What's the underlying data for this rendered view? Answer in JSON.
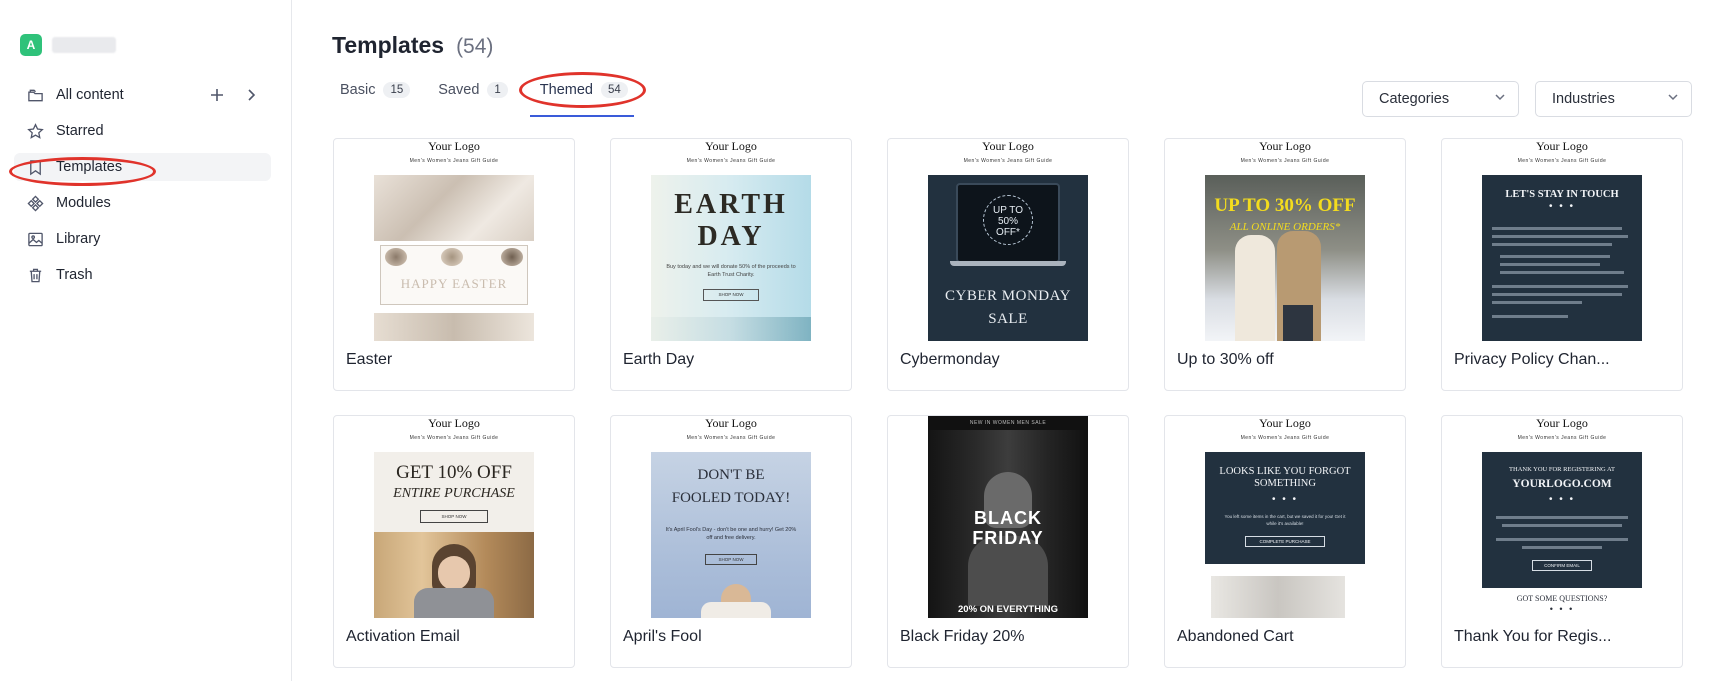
{
  "workspace": {
    "avatar_letter": "A"
  },
  "sidebar": {
    "items": [
      {
        "label": "All content",
        "icon": "folder-icon"
      },
      {
        "label": "Starred",
        "icon": "star-icon"
      },
      {
        "label": "Templates",
        "icon": "bookmark-icon"
      },
      {
        "label": "Modules",
        "icon": "modules-icon"
      },
      {
        "label": "Library",
        "icon": "image-icon"
      },
      {
        "label": "Trash",
        "icon": "trash-icon"
      }
    ]
  },
  "header": {
    "title": "Templates",
    "count": "(54)"
  },
  "tabs": [
    {
      "label": "Basic",
      "count": "15"
    },
    {
      "label": "Saved",
      "count": "1"
    },
    {
      "label": "Themed",
      "count": "54"
    }
  ],
  "filters": {
    "categories": "Categories",
    "industries": "Industries"
  },
  "templates": [
    {
      "name": "Easter",
      "logo": "Your Logo",
      "nav": "Men's   Women's   Jeans   Gift Guide",
      "headline": "HAPPY EASTER"
    },
    {
      "name": "Earth Day",
      "logo": "Your Logo",
      "nav": "Men's   Women's   Jeans   Gift Guide",
      "headline": "EARTH DAY",
      "body": "Buy today and we will donate 50% of the proceeds to Earth Trust Charity.",
      "cta": "SHOP NOW"
    },
    {
      "name": "Cybermonday",
      "logo": "Your Logo",
      "nav": "Men's   Women's   Jeans   Gift Guide",
      "badge": "UP TO 50% OFF*",
      "headline": "CYBER MONDAY SALE"
    },
    {
      "name": "Up to 30% off",
      "logo": "Your Logo",
      "nav": "Men's   Women's   Jeans   Gift Guide",
      "headline": "UP TO 30% OFF",
      "sub": "ALL ONLINE ORDERS*"
    },
    {
      "name": "Privacy Policy Chan...",
      "logo": "Your Logo",
      "nav": "Men's   Women's   Jeans   Gift Guide",
      "headline": "LET'S STAY IN TOUCH"
    },
    {
      "name": "Activation Email",
      "logo": "Your Logo",
      "nav": "Men's   Women's   Jeans   Gift Guide",
      "headline": "GET 10% OFF",
      "sub": "ENTIRE PURCHASE",
      "cta": "SHOP NOW"
    },
    {
      "name": "April's Fool",
      "logo": "Your Logo",
      "nav": "Men's   Women's   Jeans   Gift Guide",
      "headline": "DON'T BE FOOLED TODAY!",
      "body": "It's April Fool's Day - don't be one and hurry! Get 20% off and free delivery.",
      "cta": "SHOP NOW"
    },
    {
      "name": "Black Friday 20%",
      "nav": "NEW IN   WOMEN   MEN   SALE",
      "headline": "BLACK FRIDAY",
      "sub": "20% ON EVERYTHING"
    },
    {
      "name": "Abandoned Cart",
      "logo": "Your Logo",
      "nav": "Men's   Women's   Jeans   Gift Guide",
      "headline": "LOOKS LIKE YOU FORGOT SOMETHING",
      "body": "You left some items in the cart, but we saved it for you! Get it while it's available!",
      "cta": "COMPLETE PURCHASE"
    },
    {
      "name": "Thank You for Regis...",
      "logo": "Your Logo",
      "nav": "Men's   Women's   Jeans   Gift Guide",
      "headline": "THANK YOU FOR REGISTERING AT",
      "sub": "YOURLOGO.COM",
      "cta": "CONFIRM EMAIL",
      "footer": "GOT SOME QUESTIONS?"
    }
  ],
  "colors": {
    "accent": "#3a5bd9",
    "annotation": "#e0332b",
    "dark_panel": "#22313f"
  }
}
